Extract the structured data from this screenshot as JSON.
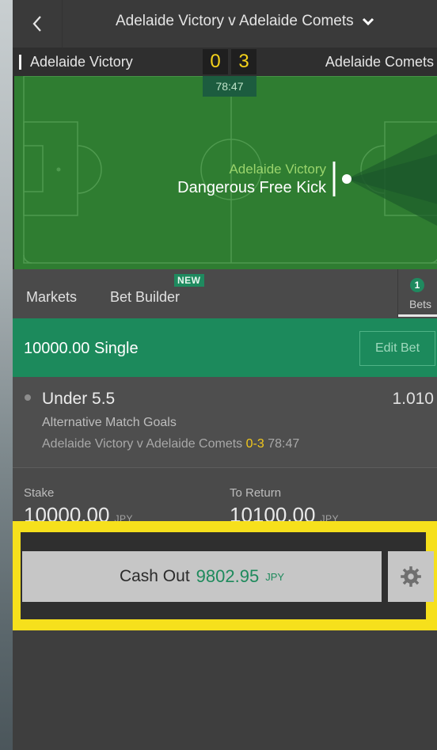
{
  "header": {
    "title": "Adelaide Victory v Adelaide Comets",
    "back_icon": "chevron-left-icon",
    "dropdown_icon": "chevron-down-icon"
  },
  "scoreboard": {
    "home_team": "Adelaide Victory",
    "away_team": "Adelaide Comets",
    "home_score": "0",
    "away_score": "3",
    "clock": "78:47"
  },
  "pitch": {
    "event_team": "Adelaide Victory",
    "event_description": "Dangerous Free Kick"
  },
  "tabs": {
    "markets": "Markets",
    "bet_builder": "Bet Builder",
    "new_badge": "NEW",
    "bets_count": "1",
    "bets": "Bets"
  },
  "bet": {
    "title": "10000.00 Single",
    "edit_label": "Edit Bet",
    "selection": "Under 5.5",
    "odds": "1.010",
    "market": "Alternative Match Goals",
    "event": "Adelaide Victory v Adelaide Comets",
    "event_score": "0-3",
    "event_time": "78:47"
  },
  "stake": {
    "stake_label": "Stake",
    "stake_value": "10000.00",
    "stake_ccy": "JPY",
    "return_label": "To Return",
    "return_value": "10100.00",
    "return_ccy": "JPY"
  },
  "cashout": {
    "label": "Cash Out",
    "amount": "9802.95",
    "currency": "JPY",
    "settings_icon": "gear-icon"
  },
  "colors": {
    "accent_green": "#1c8a5c",
    "score_yellow": "#f5d21a",
    "highlight_yellow": "#f6e01c",
    "pitch_green": "#2f7d31"
  }
}
